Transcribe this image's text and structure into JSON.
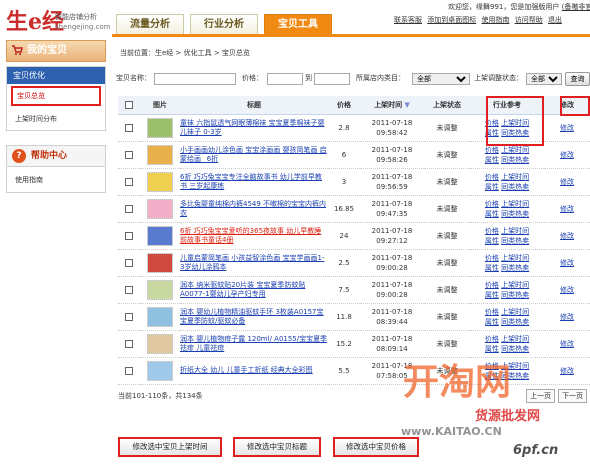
{
  "header": {
    "logo": "生e经",
    "logo_sub": "智能店铺分析",
    "logo_domain": "shengejing.com",
    "tabs": [
      "流量分析",
      "行业分析",
      "宝贝工具"
    ],
    "welcome": "欢迎您，缘舞991，您是加强版用户",
    "welcome_link": "(备嗷非官",
    "top_links": [
      "联系客服",
      "添加到桌面图标",
      "使用指南",
      "访问帮助",
      "退出"
    ]
  },
  "sidebar": {
    "title": "我的宝贝",
    "group_head": "宝贝优化",
    "items": [
      "宝贝总览",
      "上架时间分布"
    ],
    "help_title": "帮助中心",
    "help_item": "使用指南"
  },
  "main": {
    "breadcrumb": "当前位置：生e经 > 优化工具 > 宝贝总览",
    "filter": {
      "name_label": "宝贝名称：",
      "price_label": "价格：",
      "to_label": "到",
      "category_label": "所属店内类目：",
      "category_value": "全部",
      "status_label": "上架调整状态：",
      "status_value": "全部",
      "search_button": "查询"
    },
    "columns": [
      "",
      "图片",
      "标题",
      "价格",
      "上架时间",
      "上架状态",
      "行业参考",
      "修改"
    ],
    "rows": [
      {
        "title": "童袜 六指鼠透气网眼薄棉袜 宝宝夏季棉袜子婴儿袜子 0-3岁",
        "price": "2.8",
        "date": "2011-07-18",
        "time": "09:58:42",
        "status": "未调整",
        "ref1": "价格",
        "ref2": "上架时间",
        "ref3": "属性",
        "ref4": "同类热卖",
        "edit": "修改",
        "red": false,
        "color": "#9bbf6a"
      },
      {
        "title": "小手画画幼儿涂色画 宝宝涂画画 婴孩简笔画 启蒙绘画 _6折",
        "price": "6",
        "date": "2011-07-18",
        "time": "09:58:26",
        "status": "未调整",
        "ref1": "价格",
        "ref2": "上架时间",
        "ref3": "属性",
        "ref4": "同类热卖",
        "edit": "修改",
        "red": false,
        "color": "#e8b04a"
      },
      {
        "title": "6折 巧巧兔宝宝专注全脑故事书 幼儿学前早教书 三岁起康练",
        "price": "3",
        "date": "2011-07-18",
        "time": "09:56:59",
        "status": "未调整",
        "ref1": "价格",
        "ref2": "上架时间",
        "ref3": "属性",
        "ref4": "同类热卖",
        "edit": "修改",
        "red": false,
        "color": "#f0d050"
      },
      {
        "title": "多比兔婴童纯棉内裤4549 不嗽棉的宝宝内裤内衣",
        "price": "16.85",
        "date": "2011-07-18",
        "time": "09:47:35",
        "status": "未调整",
        "ref1": "价格",
        "ref2": "上架时间",
        "ref3": "属性",
        "ref4": "同类热卖",
        "edit": "修改",
        "red": false,
        "color": "#f2b0c8"
      },
      {
        "title": "6折 巧巧兔宝宝爱听的365夜故事 幼儿早教睡前故事书童话4册",
        "price": "24",
        "date": "2011-07-18",
        "time": "09:27:12",
        "status": "未调整",
        "ref1": "价格",
        "ref2": "上架时间",
        "ref3": "属性",
        "ref4": "同类热卖",
        "edit": "修改",
        "red": true,
        "color": "#5a7ad0"
      },
      {
        "title": "儿童启蒙简笔画 小孩益智涂色画 宝宝学画画1-3岁幼儿涂鸦本",
        "price": "2.5",
        "date": "2011-07-18",
        "time": "09:00:28",
        "status": "未调整",
        "ref1": "价格",
        "ref2": "上架时间",
        "ref3": "属性",
        "ref4": "同类热卖",
        "edit": "修改",
        "red": false,
        "color": "#d04a40"
      },
      {
        "title": "润本 纳米驱蚊贴20片装 宝宝夏季防蚊贴A0077-1婴幼儿孕产妇专用",
        "price": "7.5",
        "date": "2011-07-18",
        "time": "09:00:28",
        "status": "未调整",
        "ref1": "价格",
        "ref2": "上架时间",
        "ref3": "属性",
        "ref4": "同类热卖",
        "edit": "修改",
        "red": false,
        "color": "#c8d8a0"
      },
      {
        "title": "润本 婴幼儿植物精油驱蚊手环 3枚装A0157宝宝夏季防蚊/驱蚊必备",
        "price": "11.8",
        "date": "2011-07-18",
        "time": "08:39:44",
        "status": "未调整",
        "ref1": "价格",
        "ref2": "上架时间",
        "ref3": "属性",
        "ref4": "同类热卖",
        "edit": "修改",
        "red": false,
        "color": "#8fc0e0"
      },
      {
        "title": "润本 婴儿植物痱子露 120ml/ A0155/宝宝夏季祛痱 儿童祛痱",
        "price": "15.2",
        "date": "2011-07-18",
        "time": "08:09:14",
        "status": "未调整",
        "ref1": "价格",
        "ref2": "上架时间",
        "ref3": "属性",
        "ref4": "同类热卖",
        "edit": "修改",
        "red": false,
        "color": "#e0c8a0"
      },
      {
        "title": "折纸大全 幼儿 儿童手工折纸 经典大全彩图",
        "price": "5.5",
        "date": "2011-07-18",
        "time": "07:58:05",
        "status": "未调整",
        "ref1": "价格",
        "ref2": "上架时间",
        "ref3": "属性",
        "ref4": "同类热卖",
        "edit": "修改",
        "red": false,
        "color": "#a0c8e8"
      }
    ],
    "count": "当前101-110条，共134条",
    "pager": [
      "上一页",
      "下一页"
    ],
    "actions": [
      "修改选中宝贝上架时间",
      "修改选中宝贝标题",
      "修改选中宝贝价格"
    ]
  },
  "watermark": {
    "brand": "开淘网",
    "slogan": "货源批发网",
    "domain": "www.KAITAO.CN",
    "domain2": "6pf.cn"
  }
}
